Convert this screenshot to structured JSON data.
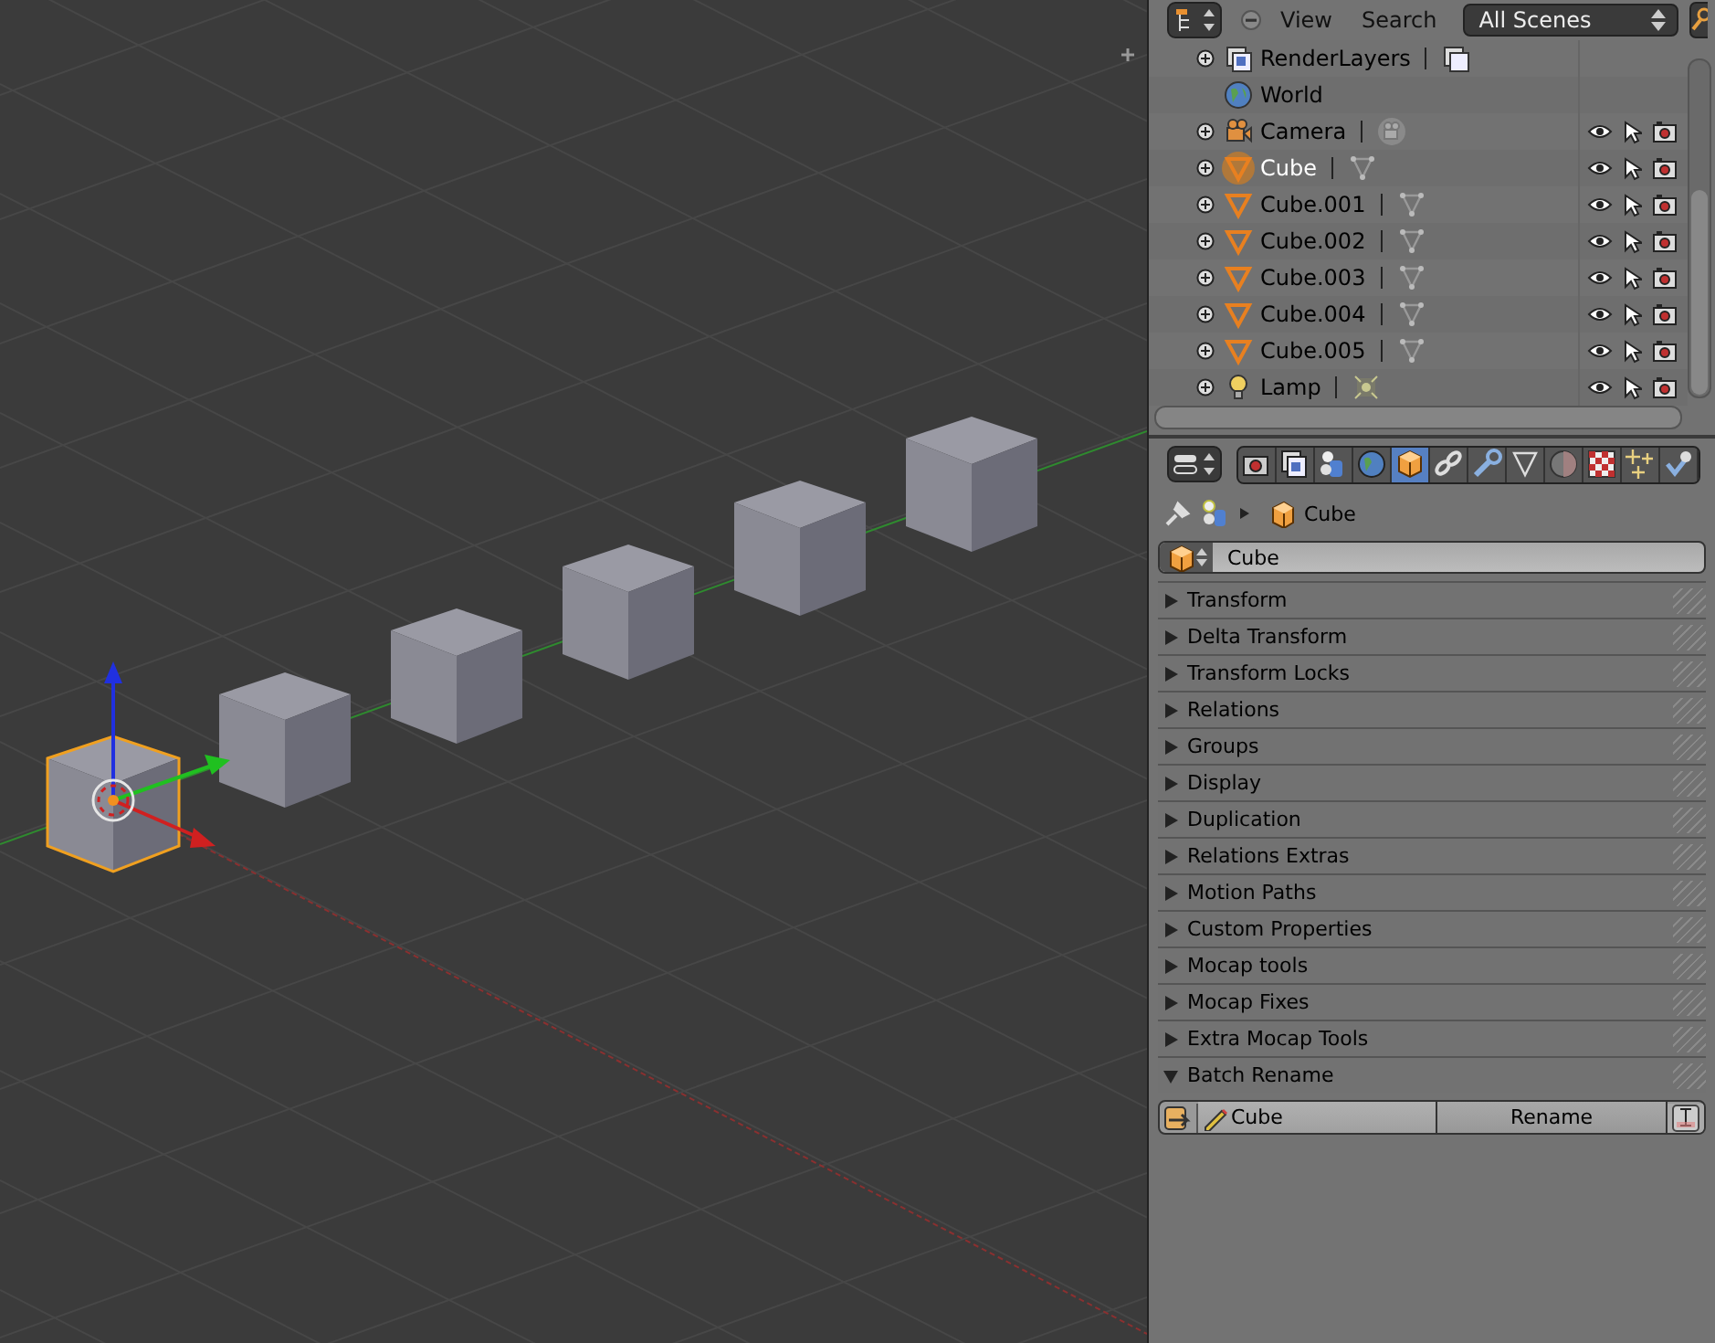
{
  "viewport": {
    "cubes": [
      {
        "selected": true
      },
      {
        "selected": false
      },
      {
        "selected": false
      },
      {
        "selected": false
      },
      {
        "selected": false
      },
      {
        "selected": false
      }
    ]
  },
  "outliner": {
    "menus": [
      "View",
      "Search"
    ],
    "scene_selector": "All Scenes",
    "items": [
      {
        "name": "RenderLayers",
        "kind": "renderlayers",
        "expandable": true,
        "selected": false
      },
      {
        "name": "World",
        "kind": "world",
        "expandable": false,
        "selected": false
      },
      {
        "name": "Camera",
        "kind": "camera",
        "expandable": true,
        "selected": false
      },
      {
        "name": "Cube",
        "kind": "mesh",
        "expandable": true,
        "selected": true
      },
      {
        "name": "Cube.001",
        "kind": "mesh",
        "expandable": true,
        "selected": false
      },
      {
        "name": "Cube.002",
        "kind": "mesh",
        "expandable": true,
        "selected": false
      },
      {
        "name": "Cube.003",
        "kind": "mesh",
        "expandable": true,
        "selected": false
      },
      {
        "name": "Cube.004",
        "kind": "mesh",
        "expandable": true,
        "selected": false
      },
      {
        "name": "Cube.005",
        "kind": "mesh",
        "expandable": true,
        "selected": false
      },
      {
        "name": "Lamp",
        "kind": "lamp",
        "expandable": true,
        "selected": false
      }
    ]
  },
  "properties": {
    "tabs": [
      {
        "kind": "render",
        "selected": false
      },
      {
        "kind": "layers",
        "selected": false
      },
      {
        "kind": "scene",
        "selected": false
      },
      {
        "kind": "world",
        "selected": false
      },
      {
        "kind": "object",
        "selected": true
      },
      {
        "kind": "constraints",
        "selected": false
      },
      {
        "kind": "modifiers",
        "selected": false
      },
      {
        "kind": "data",
        "selected": false
      },
      {
        "kind": "material",
        "selected": false
      },
      {
        "kind": "texture",
        "selected": false
      },
      {
        "kind": "particles",
        "selected": false
      },
      {
        "kind": "physics",
        "selected": false
      }
    ],
    "breadcrumb": "Cube",
    "object_name": "Cube",
    "panels": [
      {
        "label": "Transform",
        "expanded": false
      },
      {
        "label": "Delta Transform",
        "expanded": false
      },
      {
        "label": "Transform Locks",
        "expanded": false
      },
      {
        "label": "Relations",
        "expanded": false
      },
      {
        "label": "Groups",
        "expanded": false
      },
      {
        "label": "Display",
        "expanded": false
      },
      {
        "label": "Duplication",
        "expanded": false
      },
      {
        "label": "Relations Extras",
        "expanded": false
      },
      {
        "label": "Motion Paths",
        "expanded": false
      },
      {
        "label": "Custom Properties",
        "expanded": false
      },
      {
        "label": "Mocap tools",
        "expanded": false
      },
      {
        "label": "Mocap Fixes",
        "expanded": false
      },
      {
        "label": "Extra Mocap Tools",
        "expanded": false
      },
      {
        "label": "Batch Rename",
        "expanded": true
      }
    ],
    "batch_rename": {
      "value": "Cube",
      "button": "Rename"
    }
  }
}
